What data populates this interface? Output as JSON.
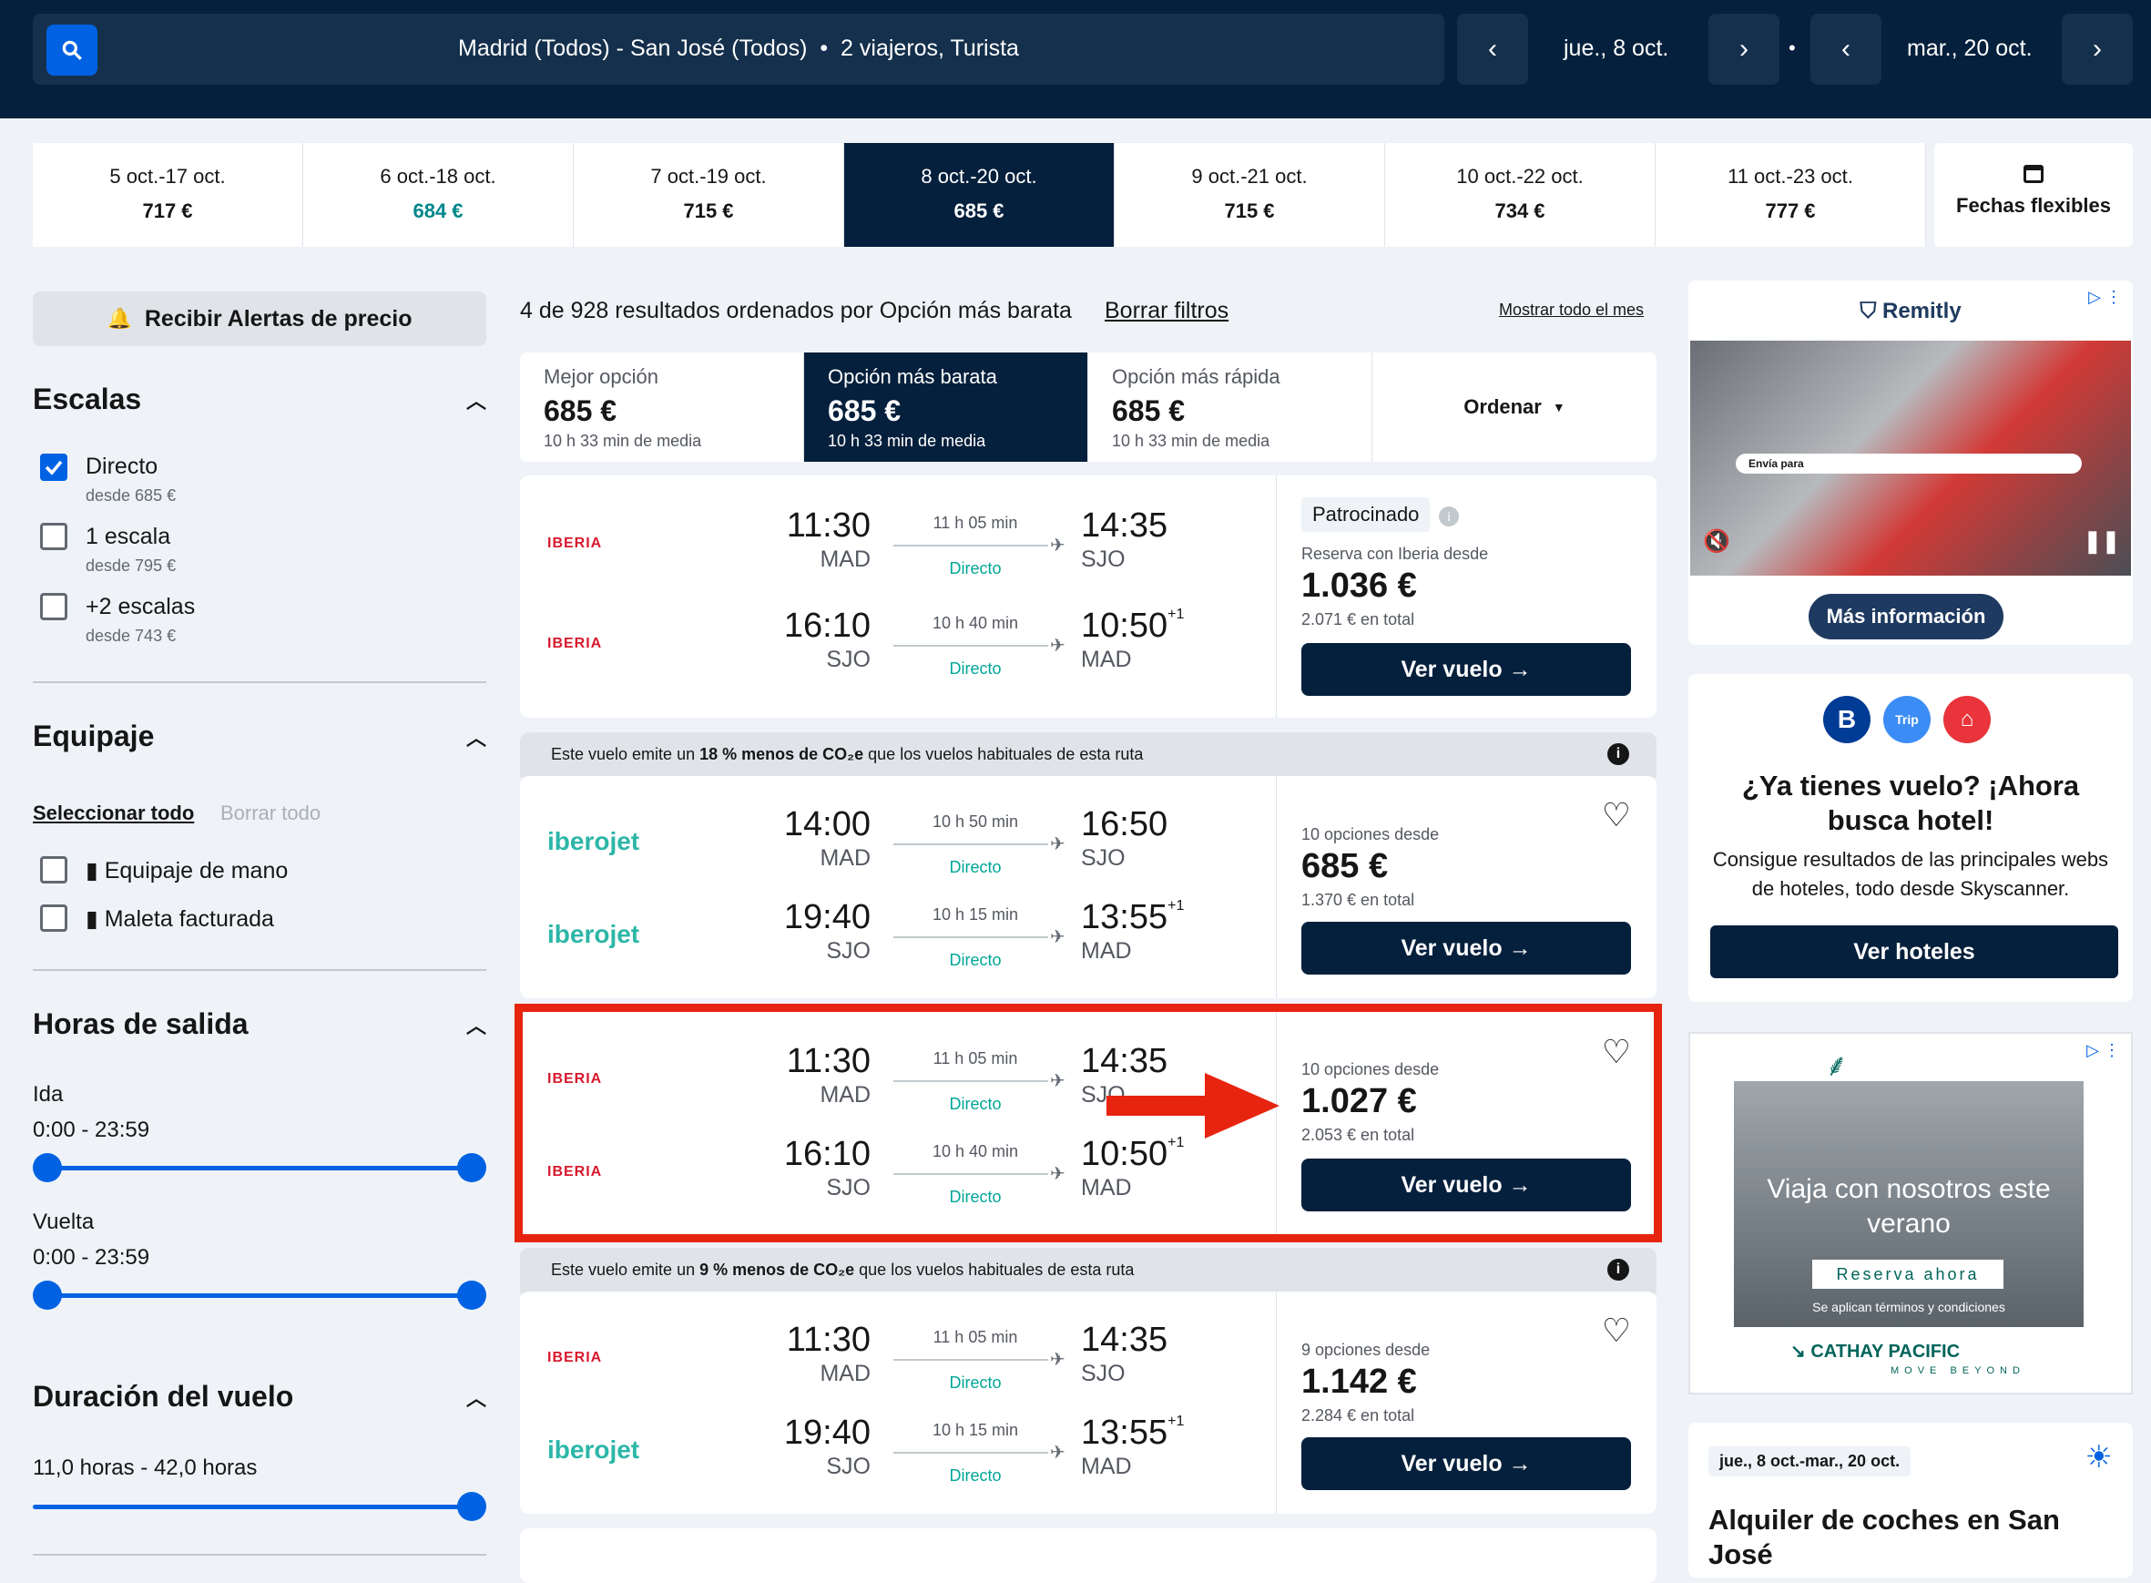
{
  "search": {
    "query": "Madrid (Todos) - San José (Todos)",
    "travellers": "2 viajeros, Turista",
    "depart_date": "jue., 8 oct.",
    "return_date": "mar., 20 oct."
  },
  "date_options": [
    {
      "label": "5 oct.-17 oct.",
      "price": "717 €"
    },
    {
      "label": "6 oct.-18 oct.",
      "price": "684 €"
    },
    {
      "label": "7 oct.-19 oct.",
      "price": "715 €"
    },
    {
      "label": "8 oct.-20 oct.",
      "price": "685 €"
    },
    {
      "label": "9 oct.-21 oct.",
      "price": "715 €"
    },
    {
      "label": "10 oct.-22 oct.",
      "price": "734 €"
    },
    {
      "label": "11 oct.-23 oct.",
      "price": "777 €"
    }
  ],
  "flexible_label": "Fechas flexibles",
  "sidebar": {
    "alert_button": "Recibir Alertas de precio",
    "stops_title": "Escalas",
    "stops": [
      {
        "label": "Directo",
        "sub": "desde 685 €",
        "checked": true
      },
      {
        "label": "1 escala",
        "sub": "desde 795 €",
        "checked": false
      },
      {
        "label": "+2 escalas",
        "sub": "desde 743 €",
        "checked": false
      }
    ],
    "baggage_title": "Equipaje",
    "select_all": "Seleccionar todo",
    "clear_all": "Borrar todo",
    "baggage": [
      "Equipaje de mano",
      "Maleta facturada"
    ],
    "times_title": "Horas de salida",
    "outbound_label": "Ida",
    "outbound_range": "0:00 - 23:59",
    "return_label": "Vuelta",
    "return_range": "0:00 - 23:59",
    "duration_title": "Duración del vuelo",
    "duration_range": "11,0 horas - 42,0 horas"
  },
  "results": {
    "summary": "4 de 928 resultados ordenados por Opción más barata",
    "clear_filters": "Borrar filtros",
    "show_month": "Mostrar todo el mes"
  },
  "sort_tabs": [
    {
      "label": "Mejor opción",
      "price": "685 €",
      "duration": "10 h 33 min de media"
    },
    {
      "label": "Opción más barata",
      "price": "685 €",
      "duration": "10 h 33 min de media"
    },
    {
      "label": "Opción más rápida",
      "price": "685 €",
      "duration": "10 h 33 min de media"
    }
  ],
  "sort_label": "Ordenar",
  "co2_notes": [
    {
      "pre": "Este vuelo emite un ",
      "bold": "18 % menos de CO₂e",
      "post": " que los vuelos habituales de esta ruta"
    },
    {
      "pre": "Este vuelo emite un ",
      "bold": "9 % menos de CO₂e",
      "post": " que los vuelos habituales de esta ruta"
    }
  ],
  "flights": [
    {
      "sponsored": "Patrocinado",
      "from": "Reserva con Iberia desde",
      "price": "1.036 €",
      "total": "2.071 € en total",
      "button": "Ver vuelo",
      "legs": [
        {
          "airline": "IBERIA",
          "dep": "11:30",
          "from": "MAD",
          "dur": "11 h 05 min",
          "stop": "Directo",
          "arr": "14:35",
          "to": "SJO",
          "plus": ""
        },
        {
          "airline": "IBERIA",
          "dep": "16:10",
          "from": "SJO",
          "dur": "10 h 40 min",
          "stop": "Directo",
          "arr": "10:50",
          "to": "MAD",
          "plus": "+1"
        }
      ]
    },
    {
      "from": "10 opciones desde",
      "price": "685 €",
      "total": "1.370 € en total",
      "button": "Ver vuelo",
      "legs": [
        {
          "airline": "iberojet",
          "dep": "14:00",
          "from": "MAD",
          "dur": "10 h 50 min",
          "stop": "Directo",
          "arr": "16:50",
          "to": "SJO",
          "plus": ""
        },
        {
          "airline": "iberojet",
          "dep": "19:40",
          "from": "SJO",
          "dur": "10 h 15 min",
          "stop": "Directo",
          "arr": "13:55",
          "to": "MAD",
          "plus": "+1"
        }
      ]
    },
    {
      "from": "10 opciones desde",
      "price": "1.027 €",
      "total": "2.053 € en total",
      "button": "Ver vuelo",
      "legs": [
        {
          "airline": "IBERIA",
          "dep": "11:30",
          "from": "MAD",
          "dur": "11 h 05 min",
          "stop": "Directo",
          "arr": "14:35",
          "to": "SJO",
          "plus": ""
        },
        {
          "airline": "IBERIA",
          "dep": "16:10",
          "from": "SJO",
          "dur": "10 h 40 min",
          "stop": "Directo",
          "arr": "10:50",
          "to": "MAD",
          "plus": "+1"
        }
      ]
    },
    {
      "from": "9 opciones desde",
      "price": "1.142 €",
      "total": "2.284 € en total",
      "button": "Ver vuelo",
      "legs": [
        {
          "airline": "IBERIA",
          "dep": "11:30",
          "from": "MAD",
          "dur": "11 h 05 min",
          "stop": "Directo",
          "arr": "14:35",
          "to": "SJO",
          "plus": ""
        },
        {
          "airline": "iberojet",
          "dep": "19:40",
          "from": "SJO",
          "dur": "10 h 15 min",
          "stop": "Directo",
          "arr": "13:55",
          "to": "MAD",
          "plus": "+1"
        }
      ]
    }
  ],
  "ads": {
    "remitly": {
      "brand": "Remitly",
      "cta": "Más información",
      "send": "Envía para"
    },
    "hotel": {
      "title": "¿Ya tienes vuelo? ¡Ahora busca hotel!",
      "body": "Consigue resultados de las principales webs de hoteles, todo desde Skyscanner.",
      "button": "Ver hoteles"
    },
    "cathay": {
      "headline": "Viaja con nosotros este verano",
      "cta": "Reserva ahora",
      "terms": "Se aplican términos y condiciones",
      "brand": "CATHAY PACIFIC",
      "tagline": "MOVE BEYOND"
    },
    "cars": {
      "dates": "jue., 8 oct.-mar., 20 oct.",
      "title": "Alquiler de coches en San José"
    }
  }
}
